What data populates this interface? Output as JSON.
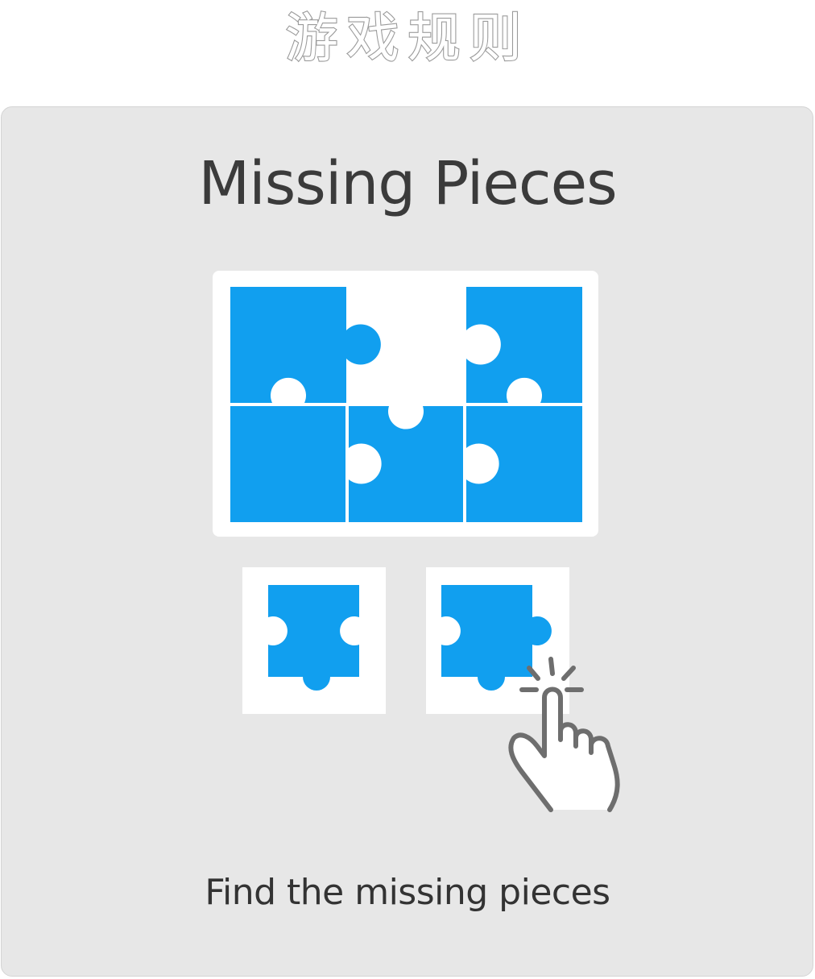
{
  "header": {
    "title": "游戏规则"
  },
  "card": {
    "title": "Missing Pieces",
    "instruction": "Find the missing pieces"
  },
  "colors": {
    "puzzle_blue": "#119fef",
    "panel_bg": "#e7e7e7",
    "board_bg": "#ffffff",
    "text": "#3b3b3b",
    "hand_outline": "#6e6e6e"
  },
  "icons": {
    "board": "puzzle-board-icon",
    "piece": "puzzle-piece-icon",
    "hand": "tap-hand-icon"
  }
}
